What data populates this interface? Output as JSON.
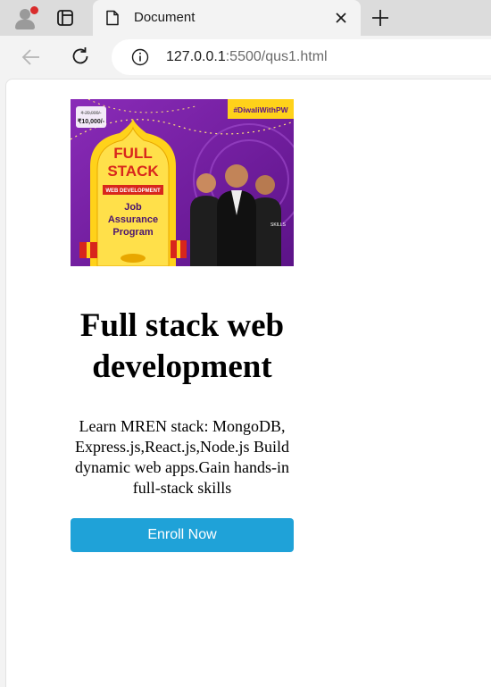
{
  "browser": {
    "tab_title": "Document",
    "url_host": "127.0.0.1",
    "url_rest": ":5500/qus1.html",
    "icons": [
      "profile-avatar-icon",
      "tab-actions-icon",
      "page-icon",
      "close-icon",
      "plus-icon",
      "back-arrow-icon",
      "reload-icon",
      "info-icon"
    ]
  },
  "page": {
    "banner": {
      "tag": "#DiwaliWithPW",
      "price_old": "₹ 20,000/-",
      "price_new": "₹10,000/-",
      "logo_line1": "FULL",
      "logo_line2": "STACK",
      "ribbon": "WEB DEVELOPMENT",
      "program_line1": "Job",
      "program_line2": "Assurance",
      "program_line3": "Program",
      "shirt_text": "SKILLS",
      "colors": {
        "purple": "#7a1fa2",
        "yellow": "#ffd21a",
        "red": "#d8261c"
      }
    },
    "title": "Full stack web development",
    "description": "Learn MREN stack: MongoDB, Express.js,React.js,Node.js Build dynamic web apps.Gain hands-in full-stack skills",
    "enroll_label": "Enroll Now",
    "accent_color": "#1fa2d8"
  }
}
